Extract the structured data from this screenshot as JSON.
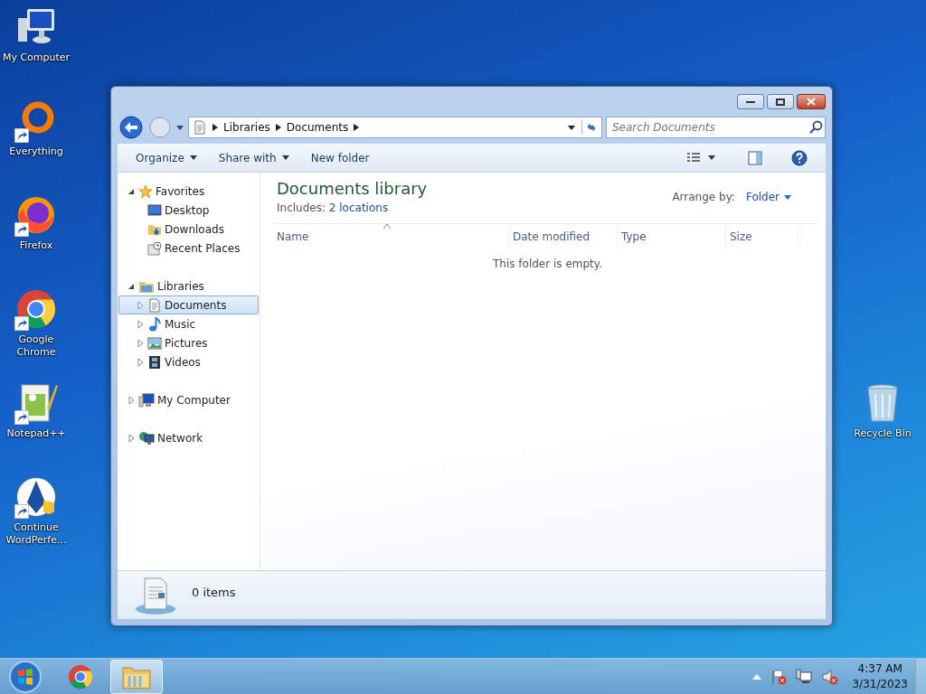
{
  "desktop_icons": [
    {
      "label": "My Computer",
      "kind": "computer",
      "shortcut": false
    },
    {
      "label": "Everything",
      "kind": "ring",
      "shortcut": true
    },
    {
      "label": "Firefox",
      "kind": "firefox",
      "shortcut": true
    },
    {
      "label": "Google Chrome",
      "kind": "chrome",
      "shortcut": true
    },
    {
      "label": "Notepad++",
      "kind": "notepad",
      "shortcut": true
    },
    {
      "label": "Continue WordPerfe...",
      "kind": "pen",
      "shortcut": true
    }
  ],
  "recycle_bin": {
    "label": "Recycle Bin"
  },
  "window": {
    "breadcrumb": [
      "Libraries",
      "Documents"
    ],
    "search": {
      "placeholder": "Search Documents"
    },
    "toolbar": [
      {
        "label": "Organize",
        "dropdown": true
      },
      {
        "label": "Share with",
        "dropdown": true
      },
      {
        "label": "New folder",
        "dropdown": false
      }
    ],
    "nav": [
      {
        "label": "Favorites",
        "kind": "star",
        "expanded": true,
        "selected": false,
        "children": [
          {
            "label": "Desktop",
            "kind": "desktop",
            "selected": false
          },
          {
            "label": "Downloads",
            "kind": "downloads",
            "selected": false
          },
          {
            "label": "Recent Places",
            "kind": "recent",
            "selected": false
          }
        ]
      },
      {
        "label": "Libraries",
        "kind": "library",
        "expanded": true,
        "selected": false,
        "children": [
          {
            "label": "Documents",
            "kind": "document",
            "expanded": false,
            "selected": true
          },
          {
            "label": "Music",
            "kind": "music",
            "expanded": false,
            "selected": false
          },
          {
            "label": "Pictures",
            "kind": "pictures",
            "expanded": false,
            "selected": false
          },
          {
            "label": "Videos",
            "kind": "videos",
            "expanded": false,
            "selected": false
          }
        ]
      },
      {
        "label": "My Computer",
        "kind": "computer",
        "expanded": false,
        "selected": false
      },
      {
        "label": "Network",
        "kind": "network",
        "expanded": false,
        "selected": false
      }
    ],
    "library": {
      "title": "Documents library",
      "includes_label": "Includes:",
      "includes_link": "2 locations",
      "arrange_label": "Arrange by:",
      "arrange_value": "Folder"
    },
    "columns": [
      "Name",
      "Date modified",
      "Type",
      "Size"
    ],
    "empty_message": "This folder is empty.",
    "status": "0 items"
  },
  "taskbar": {
    "apps": [
      {
        "kind": "chrome",
        "selected": false
      },
      {
        "kind": "explorer",
        "selected": true
      }
    ],
    "time": "4:37 AM",
    "date": "3/31/2023"
  }
}
